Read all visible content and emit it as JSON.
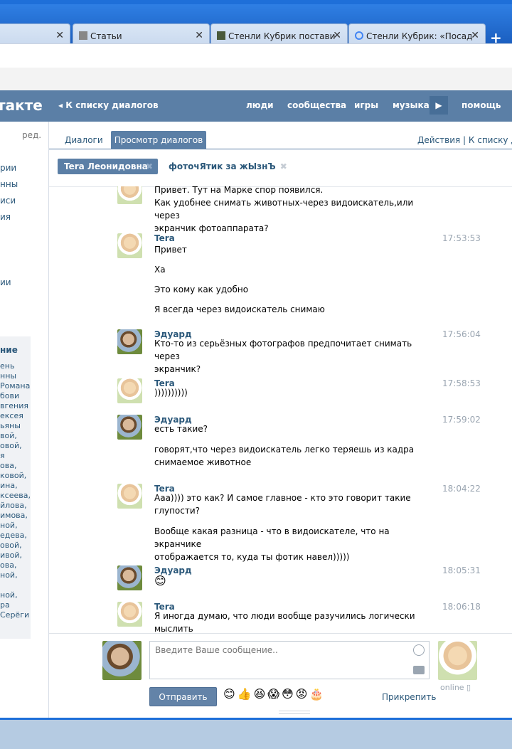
{
  "browser": {
    "tabs": [
      {
        "label": "",
        "close": "✕"
      },
      {
        "label": "Статьи",
        "close": "✕"
      },
      {
        "label": "Стенли Кубрик поставил",
        "close": "✕"
      },
      {
        "label": "Стенли Кубрик: «Посадк",
        "close": "✕"
      }
    ],
    "new_tab": "+"
  },
  "vk": {
    "logo_text": "такте",
    "back_link": "К списку диалогов",
    "nav": [
      "люди",
      "сообщества",
      "игры",
      "музыка",
      "помощь"
    ],
    "nav_arrow": "▶"
  },
  "left": {
    "edit": "ред.",
    "items": [
      "рии",
      "нны",
      "иси",
      "ия",
      "ии"
    ],
    "box_title": "ние",
    "box_names": [
      "ень",
      "нны",
      "Романа",
      "бови",
      "вгения",
      "ексея",
      "ьяны",
      "вой,",
      "овой,",
      "я",
      "ова,",
      "ковой,",
      "ина,",
      "ксеева,",
      "йлова,",
      "имова,",
      "ной,",
      "едева,",
      "овой,",
      "ивой,",
      "ова,",
      "ной,",
      "",
      "ной,",
      "ра",
      "Серёги"
    ]
  },
  "subtabs": {
    "tab1": "Диалоги",
    "tab2": "Просмотр диалогов",
    "right": "Действия  |  К списку др"
  },
  "chips": {
    "chip1": "Tera Леонидовна",
    "chip2": "фоточЯтик за жЫзнЪ",
    "close": "✖"
  },
  "messages": [
    {
      "avatar": "tera",
      "name": "",
      "time": "",
      "lines": [
        "Привет. Тут на Марке спор появился.",
        "Как удобнее снимать животных-через видоискатель,или через",
        "экранчик фотоаппарата?"
      ]
    },
    {
      "avatar": "tera",
      "name": "Tera",
      "time": "17:53:53",
      "lines": [
        "Привет",
        "",
        "Ха",
        "",
        "Это кому как удобно",
        "",
        "Я всегда через видоискатель снимаю"
      ]
    },
    {
      "avatar": "edu",
      "name": "Эдуард",
      "time": "17:56:04",
      "lines": [
        "Кто-то из серьёзных фотографов предпочитает снимать через",
        "экранчик?"
      ]
    },
    {
      "avatar": "tera",
      "name": "Tera",
      "time": "17:58:53",
      "lines": [
        "))))))))))"
      ]
    },
    {
      "avatar": "edu",
      "name": "Эдуард",
      "time": "17:59:02",
      "lines": [
        "есть такие?",
        "",
        "говорят,что через видоискатель легко теряешь из кадра",
        "снимаемое животное"
      ]
    },
    {
      "avatar": "tera",
      "name": "Tera",
      "time": "18:04:22",
      "lines": [
        "Ааа)))) это как? И самое главное - кто это говорит такие",
        "глупости?",
        "",
        "Вообще какая разница - что в видоискателе, что на экранчике",
        "отображается то, куда ты фотик навел)))))"
      ]
    },
    {
      "avatar": "edu",
      "name": "Эдуард",
      "time": "18:05:31",
      "lines": [
        "😊"
      ]
    },
    {
      "avatar": "tera",
      "name": "Tera",
      "time": "18:06:18",
      "lines": [
        "Я иногда думаю, что люди вообще разучились логически мыслить"
      ]
    }
  ],
  "composer": {
    "placeholder": "Введите Ваше сообщение..",
    "send": "Отправить",
    "emojis": "😊👍😆😱😳😡🎂",
    "attach": "Прикрепить",
    "online": "online ▯"
  }
}
